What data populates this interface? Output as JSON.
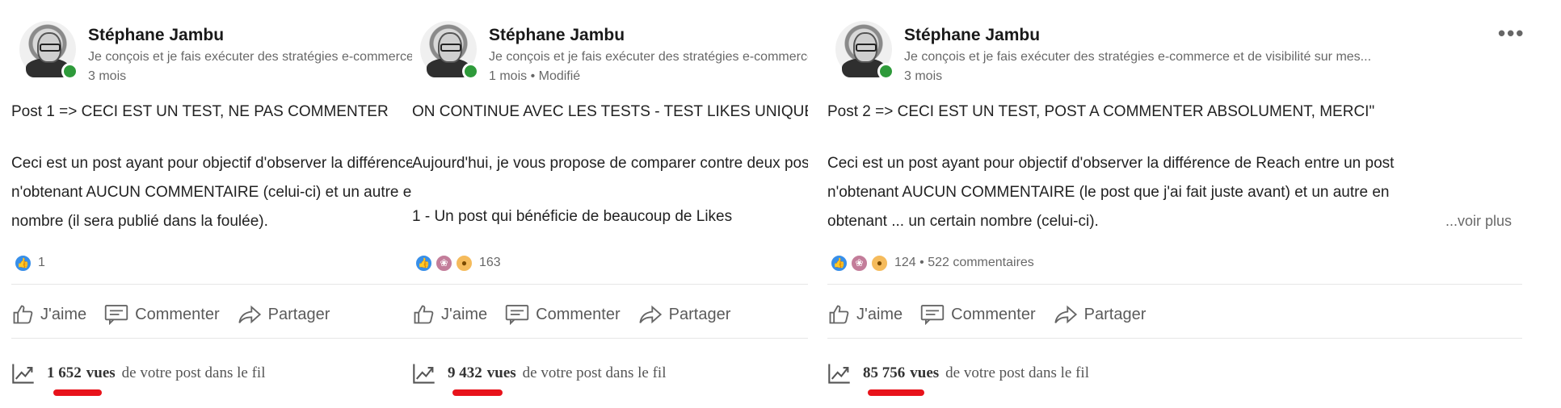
{
  "cards": [
    {
      "author_name": "Stéphane Jambu",
      "headline": "Je conçois et je fais exécuter des stratégies e-commerce et de visibilité sur mes...",
      "time": "3 mois",
      "body_lines": [
        "Post 1 => CECI EST UN TEST, NE PAS COMMENTER",
        "",
        "Ceci est un post ayant pour objectif d'observer la différence de Reach entre un post",
        "n'obtenant AUCUN COMMENTAIRE (celui-ci) et un autre en obtenant un certain",
        "nombre (il sera publié dans la foulée)."
      ],
      "reactions": [
        "like"
      ],
      "reaction_count": "1",
      "actions": {
        "like": "J'aime",
        "comment": "Commenter",
        "share": "Partager"
      },
      "views_number": "1 652",
      "views_word": "vues",
      "views_suffix": "de votre post dans le fil"
    },
    {
      "author_name": "Stéphane Jambu",
      "headline": "Je conçois et je fais exécuter des stratégies e-commerce et de visibilité sur mes...",
      "time": "1 mois • Modifié",
      "body_lines": [
        "ON CONTINUE AVEC LES TESTS - TEST LIKES UNIQUEMENT",
        "",
        "Aujourd'hui, je vous propose de comparer contre deux posts :",
        "",
        "1 - Un post qui bénéficie de beaucoup de Likes"
      ],
      "reactions": [
        "like",
        "celebrate",
        "insight"
      ],
      "reaction_count": "163",
      "actions": {
        "like": "J'aime",
        "comment": "Commenter",
        "share": "Partager"
      },
      "views_number": "9 432",
      "views_word": "vues",
      "views_suffix": "de votre post dans le fil"
    },
    {
      "author_name": "Stéphane Jambu",
      "headline": "Je conçois et je fais exécuter des stratégies e-commerce et de visibilité sur mes...",
      "time": "3 mois",
      "body_lines": [
        "Post 2 => CECI EST UN TEST, POST A COMMENTER ABSOLUMENT, MERCI\"",
        "",
        "Ceci est un post ayant pour objectif d'observer la différence de Reach entre un post",
        "n'obtenant AUCUN COMMENTAIRE (le post que j'ai fait juste avant) et un autre en",
        "obtenant ... un certain nombre (celui-ci)."
      ],
      "see_more": "...voir plus",
      "reactions": [
        "like",
        "celebrate",
        "insight"
      ],
      "reaction_count": "124 • 522 commentaires",
      "actions": {
        "like": "J'aime",
        "comment": "Commenter",
        "share": "Partager"
      },
      "views_number": "85 756",
      "views_word": "vues",
      "views_suffix": "de votre post dans le fil",
      "more_menu": "•••"
    }
  ],
  "colors": {
    "presence": "#2e9a3a",
    "highlight": "#e8131b",
    "like": "#378fe9"
  }
}
